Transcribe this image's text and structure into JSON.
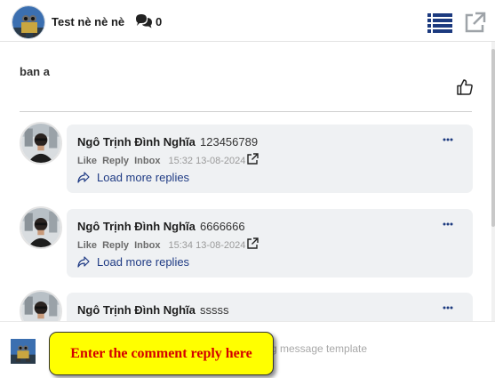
{
  "header": {
    "title": "Test nè nè nè",
    "comment_count": "0",
    "icons": {
      "chat": "chat-bubbles-icon",
      "list": "list-icon",
      "external": "external-link-icon"
    }
  },
  "post": {
    "text": "ban a",
    "like_icon": "thumbs-up-icon"
  },
  "comments": [
    {
      "author": "Ngô Trịnh Đình Nghĩa",
      "text": "123456789",
      "actions": [
        "Like",
        "Reply",
        "Inbox"
      ],
      "time": "15:32 13-08-2024",
      "load_more": "Load more replies"
    },
    {
      "author": "Ngô Trịnh Đình Nghĩa",
      "text": "6666666",
      "actions": [
        "Like",
        "Reply",
        "Inbox"
      ],
      "time": "15:34 13-08-2024",
      "load_more": "Load more replies"
    },
    {
      "author": "Ngô Trịnh Đình Nghĩa",
      "text": "sssss"
    }
  ],
  "composer": {
    "placeholder": "g message template",
    "tooltip": "Enter the comment reply here"
  },
  "colors": {
    "accent": "#1f3b84",
    "tooltip_bg": "#ffff00",
    "tooltip_text": "#d40000",
    "bubble_bg": "#eff1f3"
  }
}
